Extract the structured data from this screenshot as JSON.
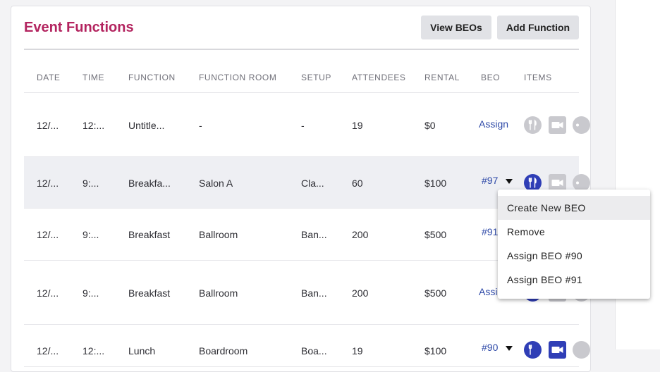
{
  "card": {
    "title": "Event Functions",
    "view_beos_label": "View BEOs",
    "add_function_label": "Add Function"
  },
  "table": {
    "headers": [
      "DATE",
      "TIME",
      "FUNCTION",
      "FUNCTION ROOM",
      "SETUP",
      "ATTENDEES",
      "RENTAL",
      "BEO",
      "ITEMS"
    ],
    "rows": [
      {
        "date": "12/...",
        "time": "12:...",
        "function": "Untitle...",
        "room": "-",
        "setup": "-",
        "attendees": "19",
        "rental": "$0",
        "beo": "Assign"
      },
      {
        "date": "12/...",
        "time": "9:...",
        "function": "Breakfa...",
        "room": "Salon A",
        "setup": "Cla...",
        "attendees": "60",
        "rental": "$100",
        "beo": "#97"
      },
      {
        "date": "12/...",
        "time": "9:...",
        "function": "Breakfast",
        "room": "Ballroom",
        "setup": "Ban...",
        "attendees": "200",
        "rental": "$500",
        "beo": "#91"
      },
      {
        "date": "12/...",
        "time": "9:...",
        "function": "Breakfast",
        "room": "Ballroom",
        "setup": "Ban...",
        "attendees": "200",
        "rental": "$500",
        "beo": "Assig"
      },
      {
        "date": "12/...",
        "time": "12:...",
        "function": "Lunch",
        "room": "Boardroom",
        "setup": "Boa...",
        "attendees": "19",
        "rental": "$100",
        "beo": "#90"
      }
    ]
  },
  "dropdown": {
    "items": [
      "Create New BEO",
      "Remove",
      "Assign BEO #90",
      "Assign BEO #91"
    ]
  },
  "colors": {
    "title": "#b3245f",
    "link": "#2f4aa8",
    "icon_active": "#2f3eb6",
    "icon_inactive": "#c9c9ce"
  },
  "icons": [
    "fork-knife-icon",
    "video-camera-icon",
    "more-icon"
  ]
}
